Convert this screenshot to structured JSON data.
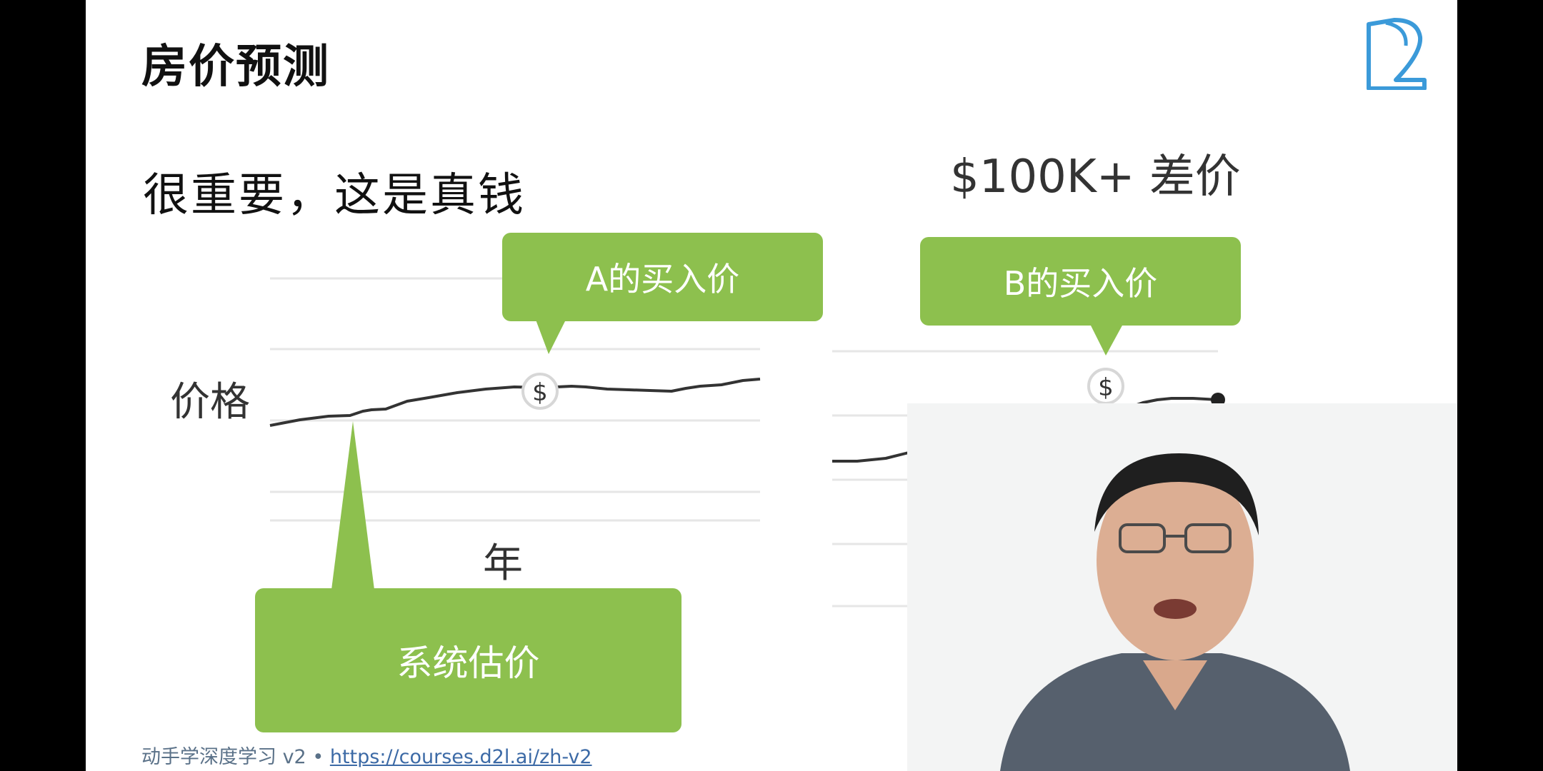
{
  "slide": {
    "title": "房价预测",
    "subtitle": "很重要，这是真钱",
    "difference_label": "$100K+ 差价",
    "y_axis_label": "价格",
    "x_axis_label": "年",
    "callout_a": "A的买入价",
    "callout_b": "B的买入价",
    "callout_system": "系统估价",
    "dollar_marker": "$"
  },
  "footer": {
    "course": "动手学深度学习 v2",
    "separator": " • ",
    "url": "https://courses.d2l.ai/zh-v2"
  },
  "colors": {
    "callout_green": "#8dc04e",
    "line_color": "#333333",
    "grid_color": "#e5e5e5",
    "logo_blue": "#3b9ad9"
  },
  "icons": {
    "logo": "d2l-logo-icon",
    "marker": "dollar-marker-icon"
  }
}
